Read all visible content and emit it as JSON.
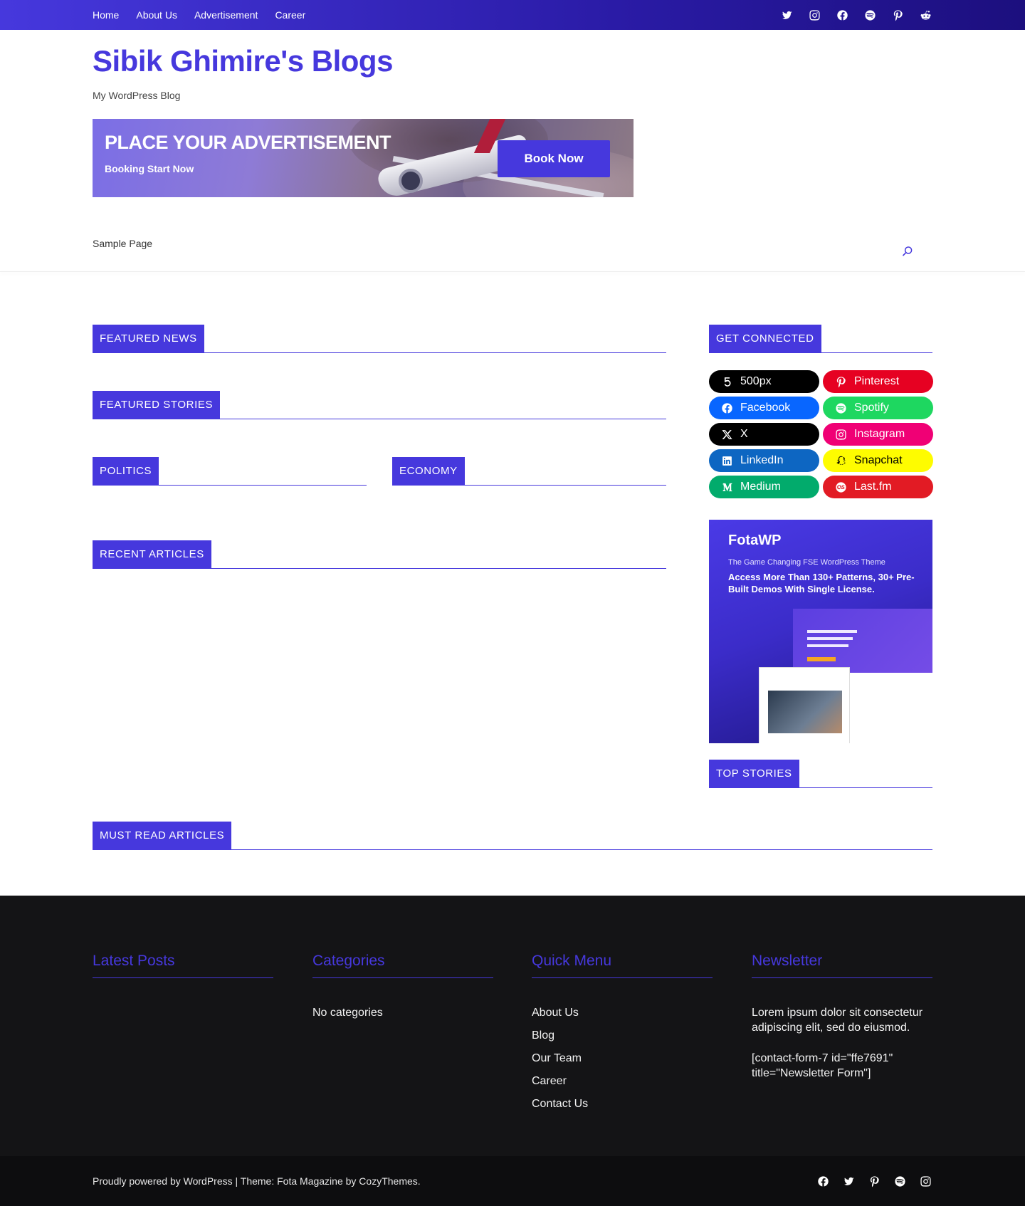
{
  "topbar": {
    "nav": [
      "Home",
      "About Us",
      "Advertisement",
      "Career"
    ],
    "social_icons": [
      "twitter-icon",
      "instagram-icon",
      "facebook-icon",
      "spotify-icon",
      "pinterest-icon",
      "reddit-icon"
    ]
  },
  "header": {
    "site_title": "Sibik Ghimire's Blogs",
    "tagline": "My WordPress Blog",
    "ad": {
      "headline": "PLACE YOUR ADVERTISEMENT",
      "subline": "Booking Start Now",
      "button": "Book Now"
    },
    "menu_item": "Sample Page"
  },
  "sections": {
    "featured_news": "FEATURED NEWS",
    "featured_stories": "FEATURED STORIES",
    "politics": "POLITICS",
    "economy": "ECONOMY",
    "recent_articles": "RECENT ARTICLES",
    "get_connected": "GET CONNECTED",
    "top_stories": "TOP STORIES",
    "must_read": "MUST READ ARTICLES"
  },
  "social_pills": [
    {
      "label": "500px",
      "icon": "500px-icon",
      "color": "#000000"
    },
    {
      "label": "Pinterest",
      "icon": "pinterest-icon",
      "color": "#e60122"
    },
    {
      "label": "Facebook",
      "icon": "facebook-icon",
      "color": "#0866ff"
    },
    {
      "label": "Spotify",
      "icon": "spotify-icon",
      "color": "#1ed760"
    },
    {
      "label": "X",
      "icon": "x-icon",
      "color": "#000000"
    },
    {
      "label": "Instagram",
      "icon": "instagram-icon",
      "color": "#f00075"
    },
    {
      "label": "LinkedIn",
      "icon": "linkedin-icon",
      "color": "#0d66c2"
    },
    {
      "label": "Snapchat",
      "icon": "snapchat-icon",
      "color": "#fefc00"
    },
    {
      "label": "Medium",
      "icon": "medium-icon",
      "color": "#02ab6c"
    },
    {
      "label": "Last.fm",
      "icon": "lastfm-icon",
      "color": "#e21b24"
    }
  ],
  "promo": {
    "title": "FotaWP",
    "subtitle": "The Game Changing FSE WordPress Theme",
    "text": "Access More Than 130+ Patterns, 30+ Pre-Built Demos With Single License."
  },
  "footer": {
    "latest_posts": "Latest Posts",
    "categories": "Categories",
    "categories_empty": "No categories",
    "quick_menu": "Quick Menu",
    "quick_links": [
      "About Us",
      "Blog",
      "Our Team",
      "Career",
      "Contact Us"
    ],
    "newsletter": "Newsletter",
    "newsletter_text": "Lorem ipsum dolor sit consectetur adipiscing elit, sed do eiusmod.",
    "newsletter_shortcode": "[contact-form-7 id=\"ffe7691\" title=\"Newsletter Form\"]",
    "credits": "Proudly powered by WordPress | Theme: Fota Magazine by  CozyThemes.",
    "social_icons": [
      "facebook-icon",
      "twitter-icon",
      "pinterest-icon",
      "spotify-icon",
      "instagram-icon"
    ]
  },
  "colors": {
    "accent": "#4638dd",
    "footer_bg": "#141416"
  }
}
